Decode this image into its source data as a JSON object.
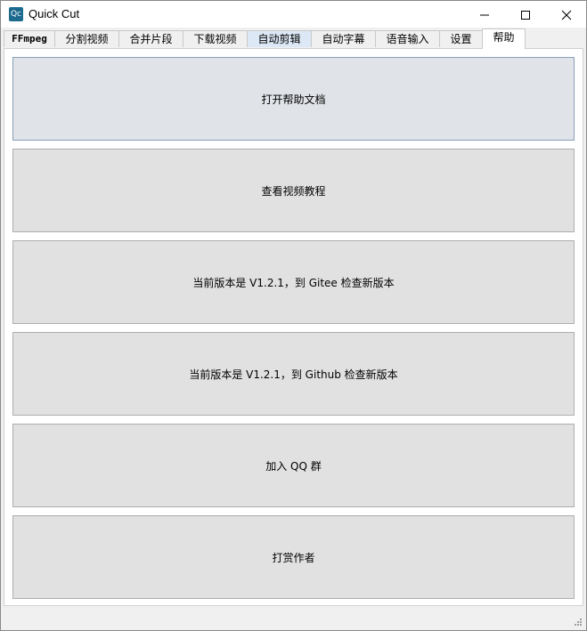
{
  "window": {
    "icon_text": "Qc",
    "title": "Quick Cut",
    "minimize_icon": "minimize-icon",
    "maximize_icon": "maximize-icon",
    "close_icon": "close-icon"
  },
  "tabs": [
    {
      "label": "FFmpeg"
    },
    {
      "label": "分割视频"
    },
    {
      "label": "合并片段"
    },
    {
      "label": "下载视频"
    },
    {
      "label": "自动剪辑"
    },
    {
      "label": "自动字幕"
    },
    {
      "label": "语音输入"
    },
    {
      "label": "设置"
    },
    {
      "label": "帮助"
    }
  ],
  "active_tab": "帮助",
  "help": {
    "buttons": [
      {
        "label": "打开帮助文档"
      },
      {
        "label": "查看视频教程"
      },
      {
        "label": "当前版本是 V1.2.1，到 Gitee 检查新版本"
      },
      {
        "label": "当前版本是 V1.2.1，到 Github 检查新版本"
      },
      {
        "label": "加入 QQ 群"
      },
      {
        "label": "打赏作者"
      }
    ]
  },
  "colors": {
    "button_bg": "#e1e1e1",
    "focused_button_bg": "#e0e3e7",
    "highlight_tab_bg": "#dce8f5",
    "app_icon_bg": "#1d6a8f"
  }
}
